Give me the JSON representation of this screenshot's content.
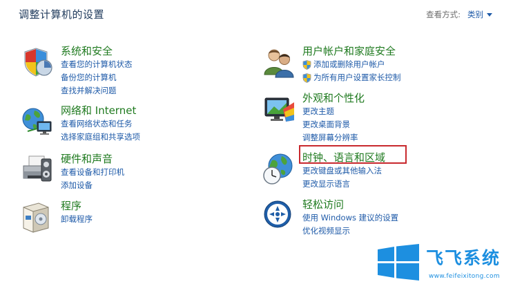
{
  "header": {
    "title": "调整计算机的设置",
    "view_by_label": "查看方式:",
    "view_by_value": "类别"
  },
  "categories": {
    "system": {
      "title": "系统和安全",
      "icon": "shield-security-icon",
      "links": [
        "查看您的计算机状态",
        "备份您的计算机",
        "查找并解决问题"
      ]
    },
    "network": {
      "title": "网络和 Internet",
      "icon": "globe-network-icon",
      "links": [
        "查看网络状态和任务",
        "选择家庭组和共享选项"
      ]
    },
    "hardware": {
      "title": "硬件和声音",
      "icon": "printer-icon",
      "links": [
        "查看设备和打印机",
        "添加设备"
      ]
    },
    "programs": {
      "title": "程序",
      "icon": "programs-box-icon",
      "links": [
        "卸载程序"
      ]
    },
    "users": {
      "title": "用户帐户和家庭安全",
      "icon": "users-icon",
      "links": [
        "添加或删除用户帐户",
        "为所有用户设置家长控制"
      ]
    },
    "appearance": {
      "title": "外观和个性化",
      "icon": "monitor-color-icon",
      "links": [
        "更改主题",
        "更改桌面背景",
        "调整屏幕分辨率"
      ]
    },
    "clock": {
      "title": "时钟、语言和区域",
      "icon": "globe-clock-icon",
      "links": [
        "更改键盘或其他输入法",
        "更改显示语言"
      ]
    },
    "ease": {
      "title": "轻松访问",
      "icon": "ease-of-access-icon",
      "links": [
        "使用 Windows 建议的设置",
        "优化视频显示"
      ]
    }
  },
  "watermark": {
    "name": "飞飞系统",
    "url": "www.feifeixitong.com"
  },
  "colors": {
    "category_title": "#1f7a1f",
    "link": "#1e5aa8",
    "highlight_border": "#c8282d",
    "watermark": "#1d8fe0"
  }
}
